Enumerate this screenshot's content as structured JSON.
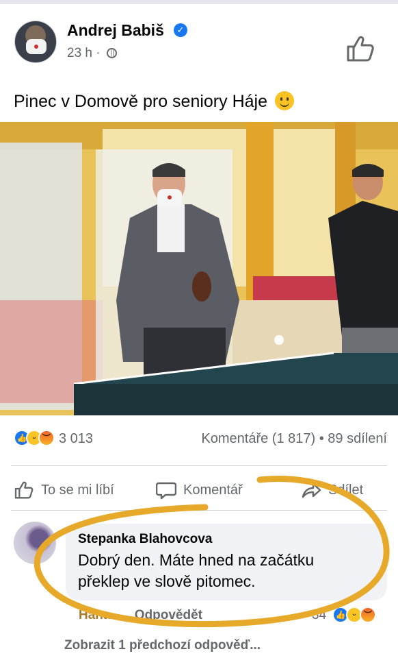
{
  "post": {
    "author": "Andrej Babiš",
    "time": "23 h",
    "time_separator": "·",
    "caption": "Pinec v Domově pro seniory Háje"
  },
  "stats": {
    "reaction_count": "3 013",
    "comments_shares": "Komentáře (1 817) • 89 sdílení"
  },
  "actions": {
    "like": "To se mi líbí",
    "comment": "Komentář",
    "share": "Sdílet"
  },
  "comment": {
    "author": "Stepanka Blahovcova",
    "text_line1": "Dobrý den. Máte hned na začátku",
    "text_line2": "překlep ve slově pitomec.",
    "like_label": "Hana",
    "reply_label": "Odpovědět",
    "reaction_count": "34"
  },
  "more_replies": "Zobrazit 1 předchozí odpověď...",
  "icons": [
    "verified-badge-icon",
    "globe-icon",
    "like-thumb-icon",
    "smiley-emoji-icon",
    "comment-bubble-icon",
    "share-arrow-icon",
    "reaction-like-icon",
    "reaction-haha-icon",
    "reaction-angry-icon"
  ],
  "colors": {
    "facebook_blue": "#1877f2",
    "secondary_text": "#65676b",
    "highlight_circle": "#e6a92a"
  }
}
